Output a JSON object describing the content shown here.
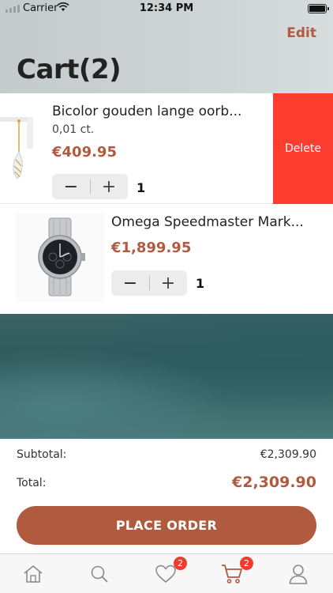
{
  "status_bar": {
    "carrier": "Carrier",
    "time": "12:34 PM"
  },
  "header": {
    "title": "Cart(2)",
    "edit_label": "Edit"
  },
  "cart": {
    "items": [
      {
        "name": "Bicolor gouden lange oorb...",
        "subtitle": "0,01 ct.",
        "price": "€409.95",
        "quantity": "1",
        "minus": "−",
        "plus": "+",
        "delete_label": "Delete",
        "thumb_icon": "earring-image"
      },
      {
        "name": "Omega Speedmaster Mark...",
        "price": "€1,899.95",
        "quantity": "1",
        "minus": "−",
        "plus": "+",
        "thumb_icon": "watch-image"
      }
    ]
  },
  "summary": {
    "subtotal_label": "Subtotal:",
    "subtotal_value": "€2,309.90",
    "total_label": "Total:",
    "total_value": "€2,309.90",
    "order_button": "PLACE ORDER"
  },
  "tabbar": {
    "tabs": [
      {
        "icon": "home-icon"
      },
      {
        "icon": "search-icon"
      },
      {
        "icon": "heart-icon",
        "badge": "2"
      },
      {
        "icon": "cart-icon",
        "badge": "2",
        "active": true
      },
      {
        "icon": "profile-icon"
      }
    ]
  },
  "colors": {
    "accent": "#b05a3f",
    "delete": "#fc3d30",
    "badge": "#f23a2f"
  }
}
